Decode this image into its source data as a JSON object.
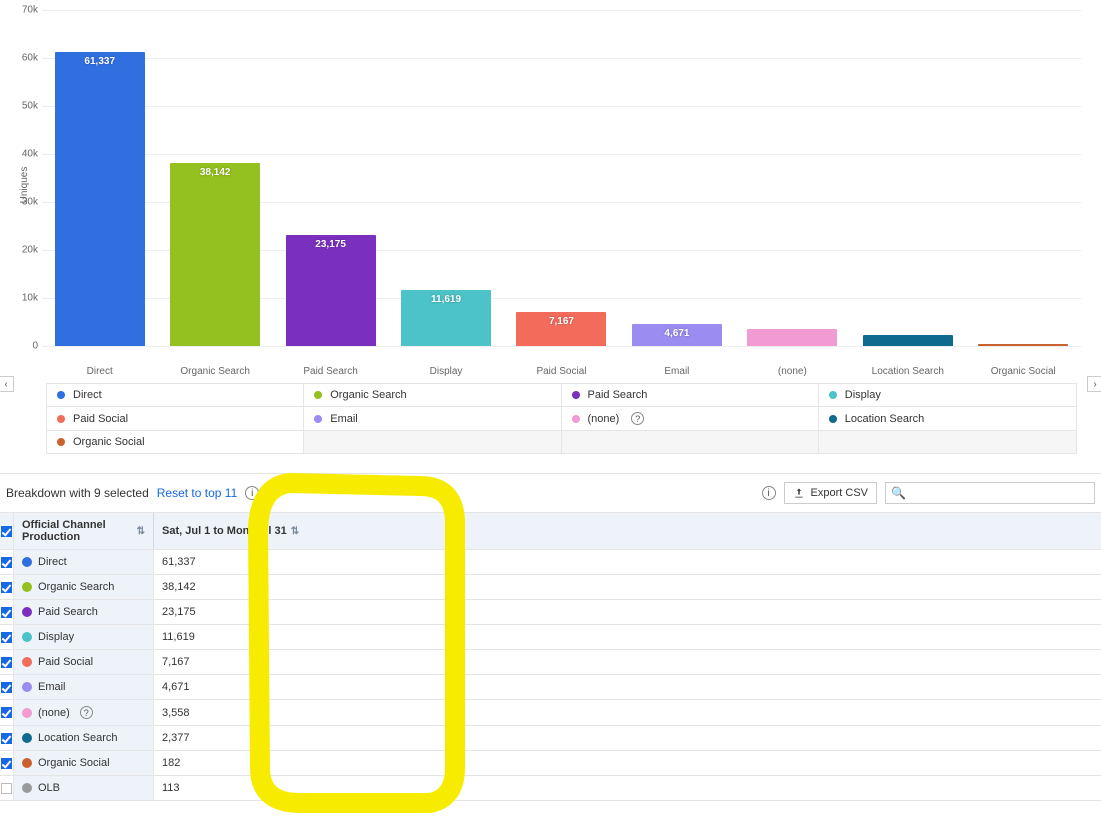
{
  "chart_data": {
    "type": "bar",
    "title": "",
    "ylabel": "Uniques",
    "xlabel": "",
    "ylim": [
      0,
      70000
    ],
    "y_ticks": [
      "0",
      "10k",
      "20k",
      "30k",
      "40k",
      "50k",
      "60k",
      "70k"
    ],
    "categories": [
      "Direct",
      "Organic Search",
      "Paid Search",
      "Display",
      "Paid Social",
      "Email",
      "(none)",
      "Location Search",
      "Organic Social"
    ],
    "series": [
      {
        "name": "Uniques",
        "values": [
          61337,
          38142,
          23175,
          11619,
          7167,
          4671,
          3558,
          2377,
          182
        ]
      }
    ],
    "colors": {
      "Direct": "#2f6fe0",
      "Organic Search": "#94c11f",
      "Paid Search": "#7b2fbf",
      "Display": "#4bc3c8",
      "Paid Social": "#f26b5b",
      "Email": "#9a8cf0",
      "(none)": "#f29ad2",
      "Location Search": "#0e6b8f",
      "Organic Social": "#c9622f",
      "OLB": "#9a9a9a"
    },
    "data_labels": [
      "61,337",
      "38,142",
      "23,175",
      "11,619",
      "7,167",
      "4,671",
      "",
      "",
      ""
    ]
  },
  "legend": {
    "rows": [
      [
        "Direct",
        "Organic Search",
        "Paid Search",
        "Display"
      ],
      [
        "Paid Social",
        "Email",
        "(none)",
        "Location Search"
      ],
      [
        "Organic Social",
        "",
        "",
        ""
      ]
    ],
    "help_on": [
      "(none)"
    ]
  },
  "toolbar": {
    "title": "Breakdown with 9 selected",
    "reset_label": "Reset to top 11",
    "export_label": "Export CSV",
    "search_placeholder": ""
  },
  "table": {
    "header_left": "Official Channel Production",
    "header_right": "Sat, Jul 1 to Mon, Jul 31",
    "rows": [
      {
        "name": "Direct",
        "value": "61,337",
        "selected": true,
        "colorKey": "Direct"
      },
      {
        "name": "Organic Search",
        "value": "38,142",
        "selected": true,
        "colorKey": "Organic Search"
      },
      {
        "name": "Paid Search",
        "value": "23,175",
        "selected": true,
        "colorKey": "Paid Search"
      },
      {
        "name": "Display",
        "value": "11,619",
        "selected": true,
        "colorKey": "Display"
      },
      {
        "name": "Paid Social",
        "value": "7,167",
        "selected": true,
        "colorKey": "Paid Social"
      },
      {
        "name": "Email",
        "value": "4,671",
        "selected": true,
        "colorKey": "Email"
      },
      {
        "name": "(none)",
        "value": "3,558",
        "selected": true,
        "colorKey": "(none)",
        "help": true
      },
      {
        "name": "Location Search",
        "value": "2,377",
        "selected": true,
        "colorKey": "Location Search"
      },
      {
        "name": "Organic Social",
        "value": "182",
        "selected": true,
        "colorKey": "Organic Social"
      },
      {
        "name": "OLB",
        "value": "113",
        "selected": false,
        "colorKey": "OLB"
      }
    ]
  }
}
